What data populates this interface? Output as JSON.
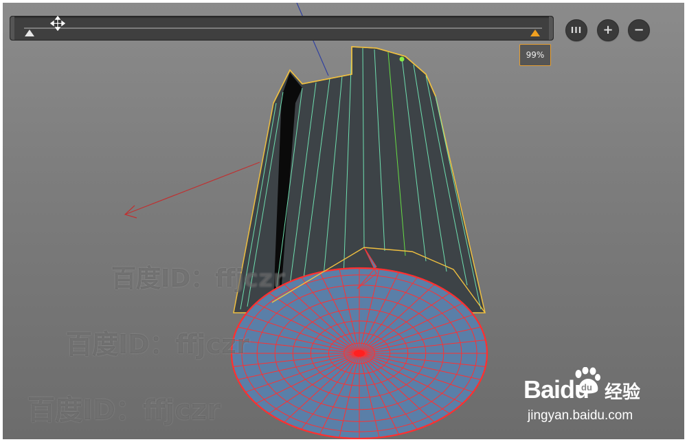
{
  "timeline": {
    "percent_label": "99%",
    "position_fraction": 0.99,
    "start_marker_color": "#e6e6e6",
    "end_marker_color": "#f0a020"
  },
  "toolbar": {
    "columns_icon": "columns-icon",
    "zoom_in_icon": "plus-icon",
    "zoom_out_icon": "minus-icon",
    "columns_glyph": "III",
    "zoom_in_glyph": "+",
    "zoom_out_glyph": "−"
  },
  "cursor": {
    "icon": "move-icon"
  },
  "viewport": {
    "object": "cylinder-mesh",
    "colors": {
      "background": "#7d7d7d",
      "side_faces": "#3d4347",
      "side_wire": "#6fe0b0",
      "selected_face": "#5a7fa8",
      "selected_wire": "#ff3030",
      "boundary_edge": "#f0c040",
      "x_axis": "#c03030",
      "z_axis": "#3040a0"
    }
  },
  "watermarks": {
    "line1": "百度ID：ffjczr",
    "line2": "百度ID：ffjczr",
    "line3": "百度ID：ffjczr"
  },
  "baidu": {
    "name": "Baidu",
    "jingyan": "经验",
    "url": "jingyan.baidu.com"
  }
}
